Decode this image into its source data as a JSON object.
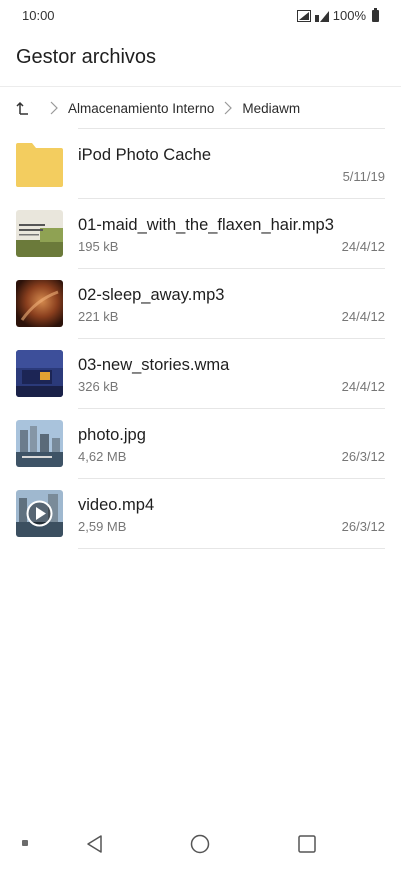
{
  "status_bar": {
    "time": "10:00",
    "battery": "100%"
  },
  "header": {
    "title": "Gestor archivos"
  },
  "breadcrumb": {
    "items": [
      "Almacenamiento Interno",
      "Mediawm"
    ]
  },
  "files": [
    {
      "name": "iPod Photo Cache",
      "size": "",
      "date": "5/11/19",
      "type": "folder"
    },
    {
      "name": "01-maid_with_the_flaxen_hair.mp3",
      "size": "195 kB",
      "date": "24/4/12",
      "type": "audio"
    },
    {
      "name": "02-sleep_away.mp3",
      "size": "221 kB",
      "date": "24/4/12",
      "type": "audio"
    },
    {
      "name": "03-new_stories.wma",
      "size": "326 kB",
      "date": "24/4/12",
      "type": "audio"
    },
    {
      "name": "photo.jpg",
      "size": "4,62 MB",
      "date": "26/3/12",
      "type": "image"
    },
    {
      "name": "video.mp4",
      "size": "2,59 MB",
      "date": "26/3/12",
      "type": "video"
    }
  ],
  "colors": {
    "folder": "#f3cd5f",
    "text_primary": "#1f1f1f",
    "text_secondary": "#777777",
    "divider": "#e6e6e6"
  }
}
